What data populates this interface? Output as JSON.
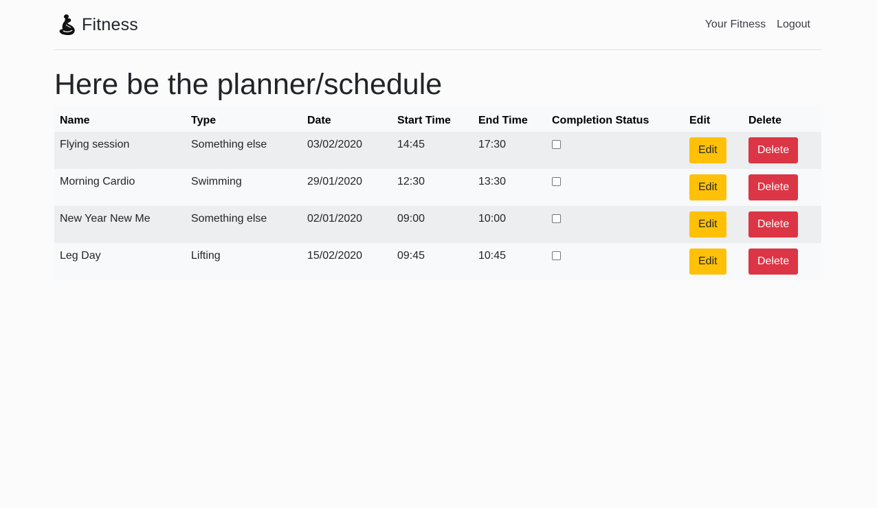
{
  "brand": {
    "name": "Fitness",
    "icon": "flexed-arm-icon"
  },
  "nav": {
    "links": [
      "Your Fitness",
      "Logout"
    ]
  },
  "page": {
    "title": "Here be the planner/schedule"
  },
  "table": {
    "headers": [
      "Name",
      "Type",
      "Date",
      "Start Time",
      "End Time",
      "Completion Status",
      "Edit",
      "Delete"
    ],
    "rows": [
      {
        "name": "Flying session",
        "type": "Something else",
        "date": "03/02/2020",
        "start": "14:45",
        "end": "17:30",
        "completed": false,
        "edit_label": "Edit",
        "delete_label": "Delete"
      },
      {
        "name": "Morning Cardio",
        "type": "Swimming",
        "date": "29/01/2020",
        "start": "12:30",
        "end": "13:30",
        "completed": false,
        "edit_label": "Edit",
        "delete_label": "Delete"
      },
      {
        "name": "New Year New Me",
        "type": "Something else",
        "date": "02/01/2020",
        "start": "09:00",
        "end": "10:00",
        "completed": false,
        "edit_label": "Edit",
        "delete_label": "Delete"
      },
      {
        "name": "Leg Day",
        "type": "Lifting",
        "date": "15/02/2020",
        "start": "09:45",
        "end": "10:45",
        "completed": false,
        "edit_label": "Edit",
        "delete_label": "Delete"
      }
    ]
  },
  "colors": {
    "edit": "#ffc107",
    "delete": "#dc3545",
    "row_striped": "#eceeef",
    "row_plain": "#f8f9fa"
  }
}
